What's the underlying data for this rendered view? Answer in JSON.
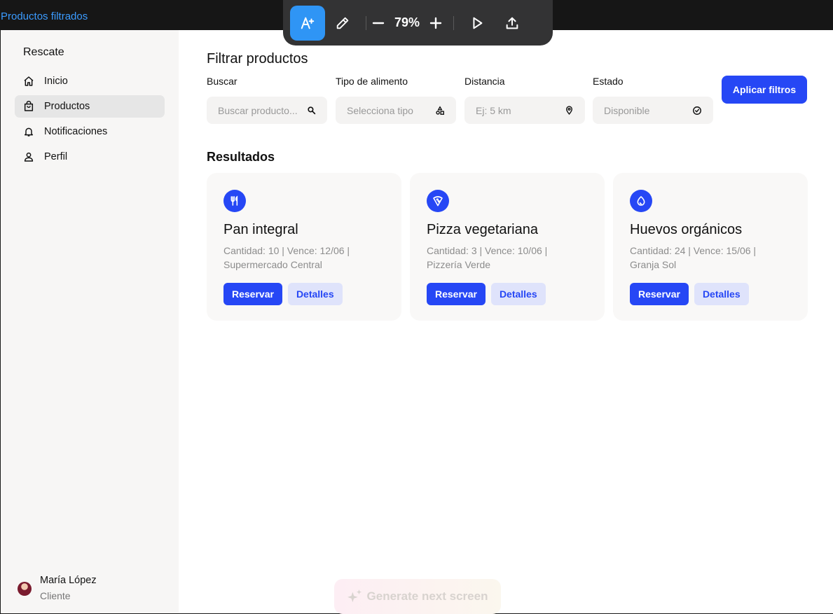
{
  "frame": {
    "title": "Productos filtrados"
  },
  "toolbar": {
    "zoom_value": "79%",
    "icons": [
      "ai-text-icon",
      "pencil-icon",
      "zoom-out-icon",
      "zoom-in-icon",
      "play-icon",
      "upload-icon"
    ]
  },
  "sidebar": {
    "brand": "Rescate",
    "items": [
      {
        "label": "Inicio",
        "icon": "home-icon",
        "active": false
      },
      {
        "label": "Productos",
        "icon": "shopping-bag-icon",
        "active": true
      },
      {
        "label": "Notificaciones",
        "icon": "bell-icon",
        "active": false
      },
      {
        "label": "Perfil",
        "icon": "user-icon",
        "active": false
      }
    ],
    "user": {
      "name": "María López",
      "role": "Cliente"
    }
  },
  "main": {
    "title": "Filtrar productos",
    "filters": [
      {
        "label": "Buscar",
        "placeholder": "Buscar producto...",
        "icon": "search-icon"
      },
      {
        "label": "Tipo de alimento",
        "placeholder": "Selecciona tipo",
        "icon": "shapes-icon"
      },
      {
        "label": "Distancia",
        "placeholder": "Ej: 5 km",
        "icon": "map-pin-icon"
      },
      {
        "label": "Estado",
        "placeholder": "Disponible",
        "icon": "check-circle-icon"
      }
    ],
    "apply_label": "Aplicar filtros",
    "results_title": "Resultados",
    "cards": [
      {
        "title": "Pan integral",
        "meta_line1": "Cantidad: 10 | Vence: 12/06 |",
        "meta_line2": "Supermercado Central",
        "icon": "utensils-icon",
        "reserve_label": "Reservar",
        "details_label": "Detalles"
      },
      {
        "title": "Pizza vegetariana",
        "meta_line1": "Cantidad: 3 | Vence: 10/06 |",
        "meta_line2": "Pizzería Verde",
        "icon": "pizza-icon",
        "reserve_label": "Reservar",
        "details_label": "Detalles"
      },
      {
        "title": "Huevos orgánicos",
        "meta_line1": "Cantidad: 24 | Vence: 15/06 |",
        "meta_line2": "Granja Sol",
        "icon": "egg-icon",
        "reserve_label": "Reservar",
        "details_label": "Detalles"
      }
    ]
  },
  "generate": {
    "label": "Generate next screen"
  },
  "colors": {
    "accent": "#2647f5",
    "toolbar_active": "#2f95f5",
    "frame_title": "#3b9bff"
  }
}
